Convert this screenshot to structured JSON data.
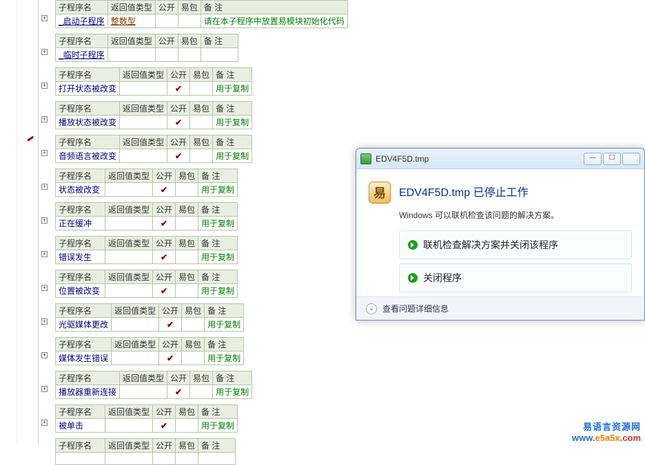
{
  "headers": {
    "name": "子程序名",
    "ret": "返回值类型",
    "pub": "公开",
    "pkg": "易包",
    "note": "备 注"
  },
  "blocks": [
    {
      "name": "_启动子程序",
      "ret": "整数型",
      "ret_cls": "brown underline",
      "pub": "",
      "note": "请在本子程序中放置易模块初始化代码",
      "note_cls": "green c-note2",
      "name_cls": "navy underline",
      "wide": false
    },
    {
      "name": "_临时子程序",
      "ret": "",
      "pub": "",
      "note": "",
      "name_cls": "navy underline",
      "name_wide": false
    },
    {
      "spacer": true
    },
    {
      "name": "打开状态被改变",
      "ret": "",
      "pub": "✓",
      "note": "用于复制",
      "note_cls": "green",
      "name_wide": true
    },
    {
      "name": "播放状态被改变",
      "ret": "",
      "pub": "✓",
      "note": "用于复制",
      "note_cls": "green",
      "name_wide": true
    },
    {
      "name": "音频语言被改变",
      "ret": "",
      "pub": "✓",
      "note": "用于复制",
      "note_cls": "green",
      "name_wide": true,
      "brush": true
    },
    {
      "name": "状态被改变",
      "ret": "",
      "pub": "✓",
      "note": "用于复制",
      "note_cls": "green"
    },
    {
      "name": "正在缓冲",
      "ret": "",
      "pub": "✓",
      "note": "用于复制",
      "note_cls": "green"
    },
    {
      "name": "错误发生",
      "ret": "",
      "pub": "✓",
      "note": "用于复制",
      "note_cls": "green",
      "ret_narrow": true
    },
    {
      "name": "位置被改变",
      "ret": "",
      "pub": "✓",
      "note": "用于复制",
      "note_cls": "green"
    },
    {
      "name": "光驱媒体更改",
      "ret": "",
      "pub": "✓",
      "note": "用于复制",
      "note_cls": "green"
    },
    {
      "name": "媒体发生错误",
      "ret": "",
      "pub": "✓",
      "note": "用于复制",
      "note_cls": "green"
    },
    {
      "name": "播放器重新连接",
      "ret": "",
      "pub": "✓",
      "note": "用于复制",
      "note_cls": "green",
      "name_wide": true
    },
    {
      "name": "被单击",
      "ret": "",
      "pub": "✓",
      "note": "用于复制",
      "note_cls": "green"
    },
    {
      "partial": true,
      "name": "",
      "ret": "",
      "pub": "",
      "note": ""
    }
  ],
  "dialog": {
    "title": "EDV4F5D.tmp",
    "msg1": "EDV4F5D.tmp 已停止工作",
    "msg2": "Windows 可以联机检查该问题的解决方案。",
    "opt1": "联机检查解决方案并关闭该程序",
    "opt2": "关闭程序",
    "details": "查看问题详细信息"
  },
  "watermark": {
    "l1": "易语言资源网",
    "l2": "www.e5a5x.com"
  }
}
